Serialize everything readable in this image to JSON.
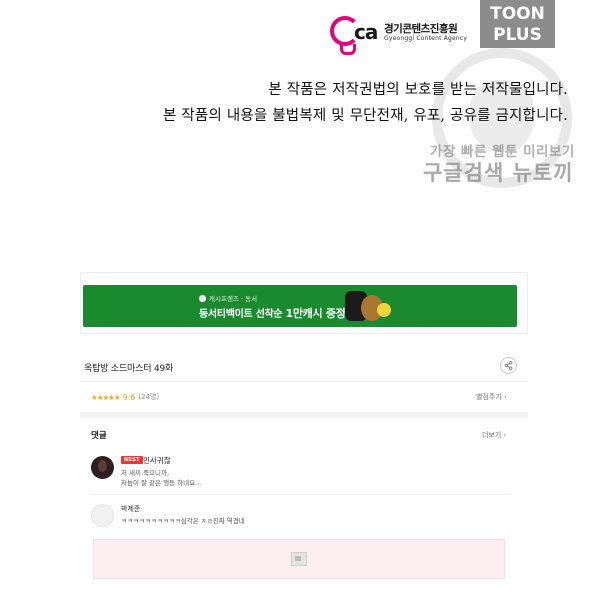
{
  "brand": {
    "agency_name_kr": "경기콘텐츠진흥원",
    "agency_name_en": "Gyeonggi Content Agency",
    "site_badge_line1": "TOON",
    "site_badge_line2": "PLUS"
  },
  "notice": {
    "line1": "본 작품은 저작권법의 보호를 받는 저작물입니다.",
    "line2": "본 작품의 내용을 불법복제 및 무단전재, 유포, 공유를 금지합니다."
  },
  "watermark": {
    "line1": "가장 빠른 웹툰 미리보기",
    "line2": "구글검색 뉴토끼"
  },
  "banner_ad": {
    "brand_line": "캐시프렌즈 · 동서",
    "headline_prefix": "동서티백이트 선착순",
    "headline_highlight": "1만캐시 증정",
    "accent_color": "#1a8a2e"
  },
  "episode": {
    "title": "옥탑방 소드마스터 49화",
    "share_icon": "share-icon",
    "stars": "★★★★★",
    "score": "9.6",
    "votes": "(24명)",
    "rate_link": "별점주기 ›"
  },
  "comments": {
    "header": "댓글",
    "more_link": "더보기 ›",
    "items": [
      {
        "badge": "BEST",
        "user": "민사귀찮",
        "line1": "저 새끼 죽으니까,",
        "line2": "저놈이 잘 같은 행동 하네요..."
      },
      {
        "user": "박제준",
        "line1": "ㅋㅋㅋㅋㅋㅋㅋㅋㅋㅋ심각은 ㅈㄹ진짜 역겹네"
      }
    ]
  }
}
